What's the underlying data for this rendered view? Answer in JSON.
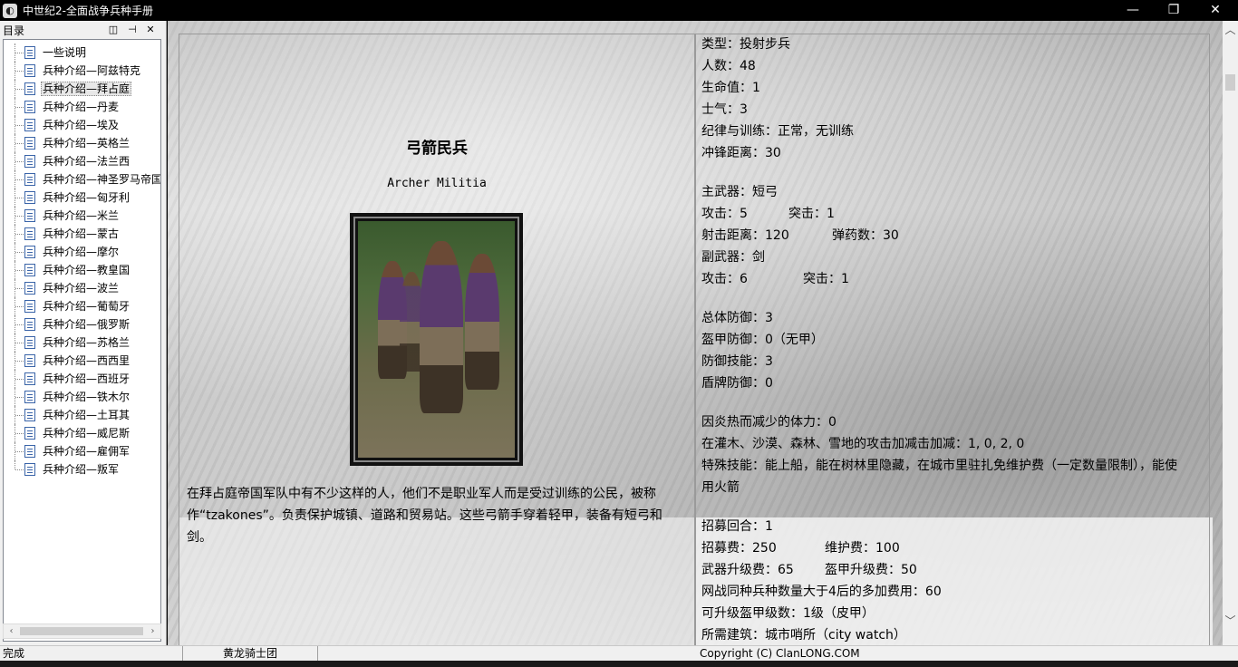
{
  "window": {
    "title": "中世纪2-全面战争兵种手册",
    "app_icon": "app-icon",
    "controls": [
      "minimize",
      "restore",
      "close"
    ]
  },
  "toc": {
    "header": "目录",
    "items": [
      "一些说明",
      "兵种介绍—阿兹特克",
      "兵种介绍—拜占庭",
      "兵种介绍—丹麦",
      "兵种介绍—埃及",
      "兵种介绍—英格兰",
      "兵种介绍—法兰西",
      "兵种介绍—神圣罗马帝国",
      "兵种介绍—匈牙利",
      "兵种介绍—米兰",
      "兵种介绍—蒙古",
      "兵种介绍—摩尔",
      "兵种介绍—教皇国",
      "兵种介绍—波兰",
      "兵种介绍—葡萄牙",
      "兵种介绍—俄罗斯",
      "兵种介绍—苏格兰",
      "兵种介绍—西西里",
      "兵种介绍—西班牙",
      "兵种介绍—铁木尔",
      "兵种介绍—土耳其",
      "兵种介绍—威尼斯",
      "兵种介绍—雇佣军",
      "兵种介绍—叛军"
    ],
    "selected_index": 2
  },
  "unit": {
    "name_cn": "弓箭民兵",
    "name_en": "Archer Militia",
    "description": "在拜占庭帝国军队中有不少这样的人，他们不是职业军人而是受过训练的公民，被称作“tzakones”。负责保护城镇、道路和贸易站。这些弓箭手穿着轻甲，装备有短弓和剑。"
  },
  "stats": {
    "type": "类型：投射步兵",
    "men": "人数：48",
    "hp": "生命值：1",
    "morale": "士气：3",
    "discipline": "纪律与训练：正常，无训练",
    "charge_dist": "冲锋距离：30",
    "primary_weapon": "主武器：短弓",
    "primary_attack": "攻击：5",
    "primary_charge": "突击：1",
    "range": "射击距离：120",
    "ammo": "弹药数：30",
    "secondary_weapon": "副武器：剑",
    "secondary_attack": "攻击：6",
    "secondary_charge": "突击：1",
    "total_defense": "总体防御：3",
    "armour": "盔甲防御：0（无甲）",
    "defense_skill": "防御技能：3",
    "shield": "盾牌防御：0",
    "heat": "因炎热而减少的体力：0",
    "terrain": "在灌木、沙漠、森林、雪地的攻击加减击加减：1, 0, 2, 0",
    "special": "特殊技能：能上船，能在树林里隐藏，在城市里驻扎免维护费（一定数量限制），能使用火箭",
    "recruit_turns": "招募回合：1",
    "recruit_cost": "招募费：250",
    "upkeep": "维护费：100",
    "weapon_upgrade": "武器升级费：65",
    "armour_upgrade": "盔甲升级费：50",
    "online_extra": "网战同种兵种数量大于4后的多加费用：60",
    "armour_levels": "可升级盔甲级数：1级（皮甲）",
    "building": "所需建筑：城市哨所（city watch）"
  },
  "statusbar": {
    "status": "完成",
    "author": "黄龙骑士团",
    "copyright": "Copyright (C) ClanLONG.COM"
  }
}
